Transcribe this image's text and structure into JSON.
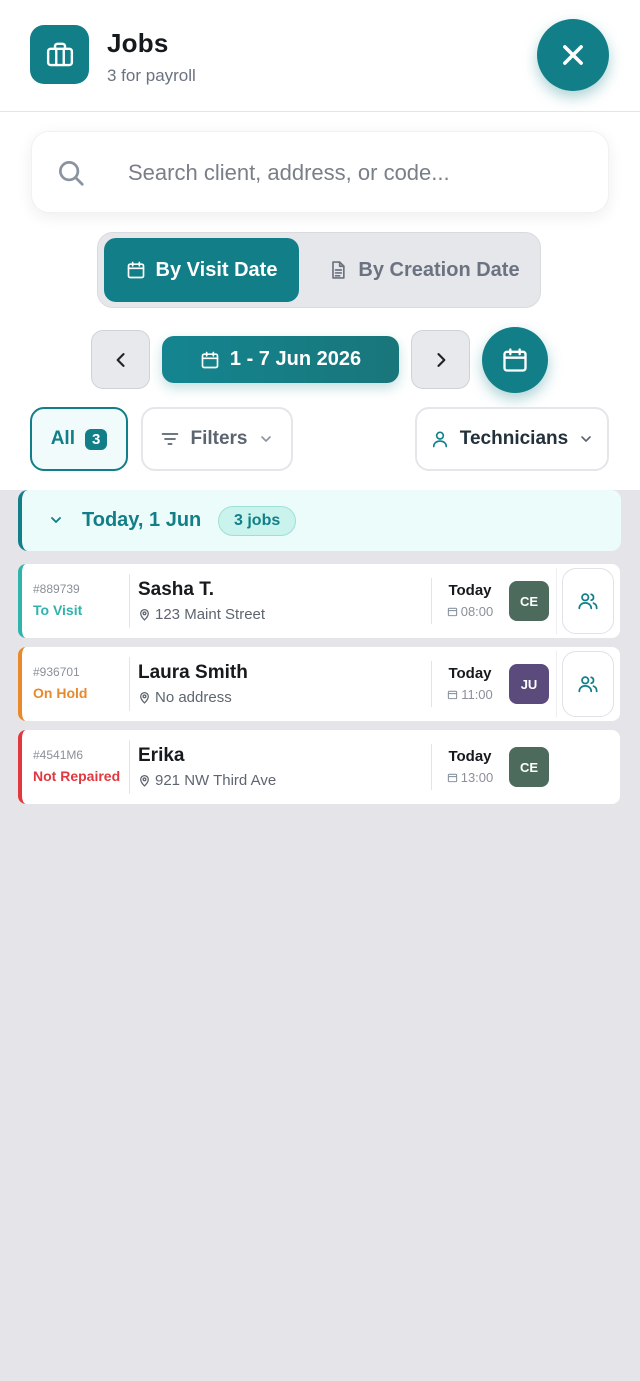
{
  "header": {
    "title": "Jobs",
    "subtitle": "3 for payroll"
  },
  "search": {
    "placeholder": "Search client, address, or code..."
  },
  "date_mode": {
    "active_label": "By Visit Date",
    "inactive_label": "By Creation Date"
  },
  "date_range": {
    "label": "1 - 7 Jun 2026"
  },
  "filters": {
    "all_label": "All",
    "all_count": "3",
    "filters_label": "Filters",
    "technicians_label": "Technicians"
  },
  "group": {
    "title": "Today, 1 Jun",
    "count_label": "3 jobs"
  },
  "jobs": [
    {
      "code": "#889739",
      "status": "To Visit",
      "client": "Sasha T.",
      "address": "123 Maint Street",
      "day": "Today",
      "time": "08:00",
      "tech_initials": "CE",
      "has_team_button": true
    },
    {
      "code": "#936701",
      "status": "On Hold",
      "client": "Laura Smith",
      "address": "No address",
      "day": "Today",
      "time": "11:00",
      "tech_initials": "JU",
      "has_team_button": true
    },
    {
      "code": "#4541M6",
      "status": "Not Repaired",
      "client": "Erika",
      "address": "921 NW Third Ave",
      "day": "Today",
      "time": "13:00",
      "tech_initials": "CE",
      "has_team_button": false
    }
  ],
  "colors": {
    "accent": "#127f88",
    "status_to_visit": "#2fb3ab",
    "status_on_hold": "#e8892b",
    "status_not_repaired": "#e0383e",
    "avatar_ce": "#4d6b5c",
    "avatar_ju": "#5b4b7c"
  },
  "icons": {
    "app": "briefcase-icon",
    "close": "close-icon",
    "search": "search-icon",
    "visit_date": "calendar-icon",
    "creation_date": "document-icon",
    "prev": "chevron-left-icon",
    "next": "chevron-right-icon",
    "calendar": "calendar-icon",
    "filters": "filter-lines-icon",
    "technicians": "person-icon",
    "location": "map-pin-icon",
    "time": "calendar-small-icon",
    "team": "users-icon"
  }
}
